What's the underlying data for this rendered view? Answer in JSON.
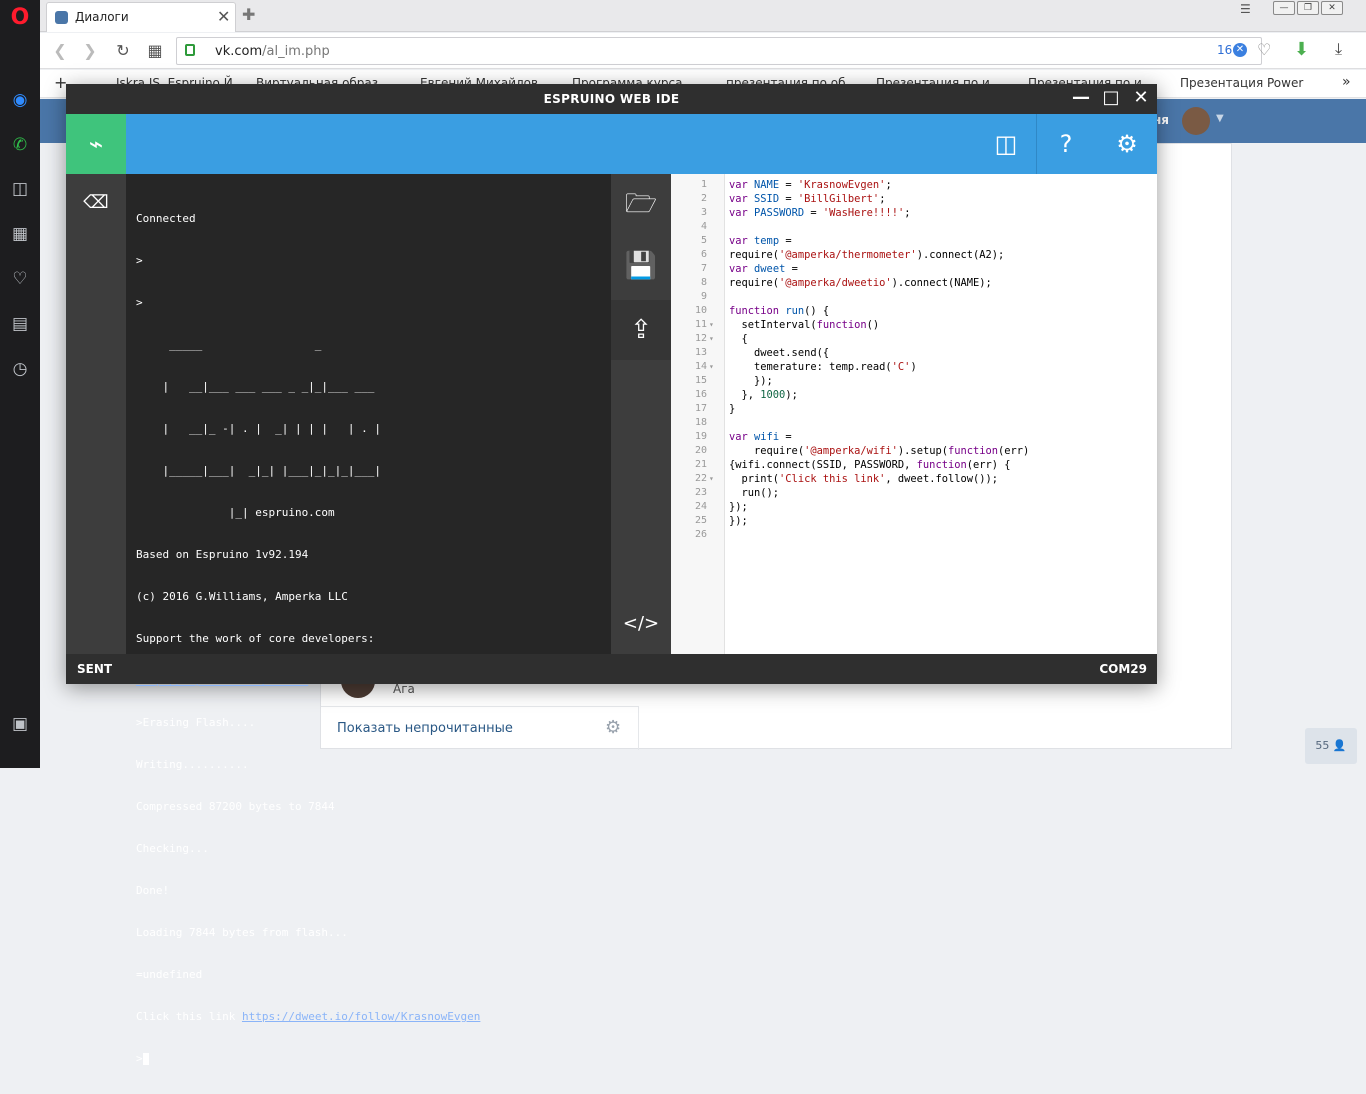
{
  "browser": {
    "tab_title": "Диалоги",
    "url_host": "vk.com",
    "url_path": "/al_im.php",
    "url_badge": "16",
    "bookmarks": [
      "Iskra JS. Espruino Й...",
      "Виртуальная образ...",
      "Евгений Михайлов...",
      "Программа курса...",
      "презентация по об...",
      "Презентация по и...",
      "Презентация по и...",
      "Презентация Power"
    ]
  },
  "vk": {
    "header_text": "ня",
    "dialog_snippet": "Ага",
    "show_unread": "Показать непрочитанные",
    "counter": "55"
  },
  "ide": {
    "title": "ESPRUINO WEB IDE",
    "status_left": "SENT",
    "status_right": "COM29",
    "terminal": [
      "Connected",
      ">",
      ">",
      "     _____                 _",
      "    |   __|___ ___ ___ _ _|_|___ ___",
      "    |   __|_ -| . |  _| | | |   | . |",
      "    |_____|___|  _|_| |___|_|_|_|___|",
      "              |_| espruino.com",
      "Based on Espruino 1v92.194",
      "(c) 2016 G.Williams, Amperka LLC",
      "Support the work of core developers:"
    ],
    "terminal_link1": "http://espruino.com/Donate",
    "terminal_after": [
      ">Erasing Flash....",
      "Writing..........",
      "Compressed 87200 bytes to 7844",
      "Checking...",
      "Done!",
      "Loading 7844 bytes from flash...",
      "=undefined"
    ],
    "terminal_click_prefix": "Click this link ",
    "terminal_link2": "https://dweet.io/follow/KrasnowEvgen",
    "terminal_prompt": ">",
    "line_numbers": "1\n2\n3\n4\n5\n6\n7\n8\n9\n10\n11\n12\n13\n14\n15\n16\n17\n18\n19\n20\n21\n22\n23\n24\n25\n26"
  },
  "colors": {
    "ide_toolbar": "#3a9ee2",
    "ide_connect": "#3fc47c",
    "vk_header": "#4a76a8"
  }
}
